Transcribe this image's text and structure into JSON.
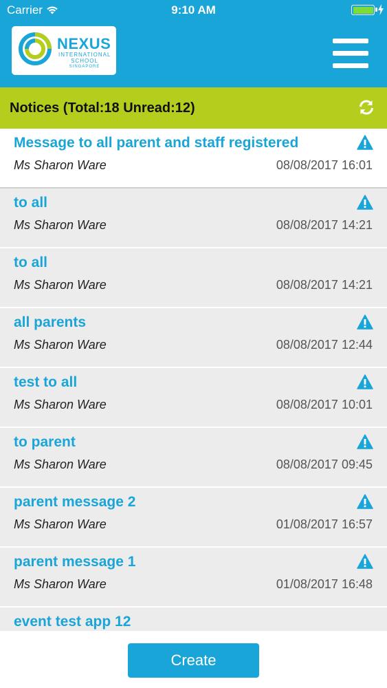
{
  "status_bar": {
    "carrier": "Carrier",
    "time": "9:10 AM",
    "icons": [
      "wifi-icon",
      "battery-icon",
      "charging-icon"
    ]
  },
  "header": {
    "logo": {
      "word": "NEXUS",
      "line1": "INTERNATIONAL",
      "line2": "SCHOOL",
      "line3": "SINGAPORE"
    },
    "menu_icon": "hamburger-menu-icon"
  },
  "notices": {
    "title": "Notices (Total:18 Unread:12)",
    "refresh_icon": "refresh-icon",
    "items": [
      {
        "title": "Message to all parent and staff registered",
        "sender": "Ms Sharon Ware",
        "date": "08/08/2017 16:01",
        "alert": true
      },
      {
        "title": "to all",
        "sender": "Ms Sharon Ware",
        "date": "08/08/2017 14:21",
        "alert": true
      },
      {
        "title": "to all",
        "sender": "Ms Sharon Ware",
        "date": "08/08/2017 14:21",
        "alert": false
      },
      {
        "title": "all parents",
        "sender": "Ms Sharon Ware",
        "date": "08/08/2017 12:44",
        "alert": true
      },
      {
        "title": "test to all",
        "sender": "Ms Sharon Ware",
        "date": "08/08/2017 10:01",
        "alert": true
      },
      {
        "title": "to parent",
        "sender": "Ms Sharon Ware",
        "date": "08/08/2017 09:45",
        "alert": true
      },
      {
        "title": "parent message 2",
        "sender": "Ms Sharon Ware",
        "date": "01/08/2017 16:57",
        "alert": true
      },
      {
        "title": "parent message 1",
        "sender": "Ms Sharon Ware",
        "date": "01/08/2017 16:48",
        "alert": true
      },
      {
        "title": "event test app 12",
        "sender": "",
        "date": "",
        "alert": false
      }
    ]
  },
  "footer": {
    "create_label": "Create"
  },
  "colors": {
    "brand_blue": "#1aa5d8",
    "notices_bar": "#b5cd1d",
    "battery": "#7ddc3c"
  }
}
